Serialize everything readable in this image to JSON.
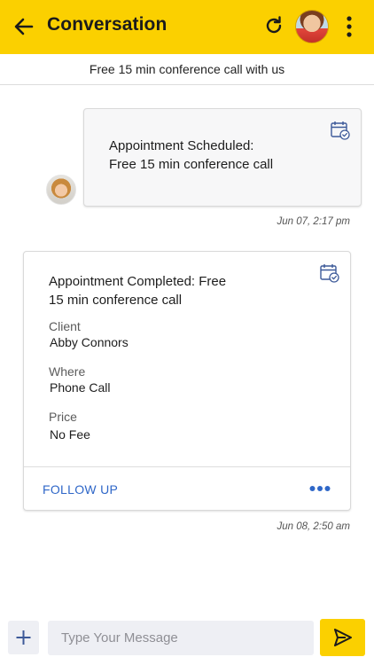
{
  "header": {
    "title": "Conversation",
    "back_icon": "arrow-left-icon",
    "refresh_icon": "refresh-icon",
    "menu_icon": "kebab-menu-icon",
    "background_color": "#fbd000"
  },
  "subheader": {
    "text": "Free 15 min conference call with us"
  },
  "messages": [
    {
      "type": "appointment_scheduled",
      "heading_line1": "Appointment Scheduled:",
      "heading_line2": "Free 15 min conference call",
      "icon": "calendar-check-icon",
      "timestamp": "Jun 07, 2:17 pm"
    },
    {
      "type": "appointment_completed",
      "heading_line1": "Appointment Completed:  Free",
      "heading_line2": "15 min conference call",
      "icon": "calendar-check-icon",
      "fields": [
        {
          "label": "Client",
          "value": "Abby Connors"
        },
        {
          "label": "Where",
          "value": "Phone Call"
        },
        {
          "label": "Price",
          "value": "No Fee"
        }
      ],
      "action_label": "FOLLOW UP",
      "more_icon": "more-dots-icon",
      "timestamp": "Jun 08, 2:50 am"
    }
  ],
  "composer": {
    "add_icon": "plus-icon",
    "placeholder": "Type Your Message",
    "send_icon": "send-icon"
  },
  "colors": {
    "accent": "#fbd000",
    "link": "#2f67c8",
    "icon_blue": "#3d5a99"
  }
}
